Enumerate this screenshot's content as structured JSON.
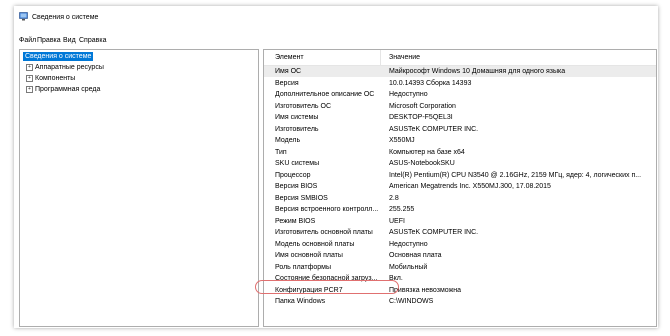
{
  "window": {
    "title": "Сведения о системе"
  },
  "menu": [
    "Файл",
    "Правка",
    "Вид",
    "Справка"
  ],
  "tree": [
    {
      "label": "Сведения о системе",
      "selected": true
    },
    {
      "label": "Аппаратные ресурсы"
    },
    {
      "label": "Компоненты"
    },
    {
      "label": "Программная среда"
    }
  ],
  "table": {
    "headers": [
      "Элемент",
      "Значение"
    ],
    "rows": [
      [
        "Имя ОС",
        "Майкрософт Windows 10 Домашняя для одного языка"
      ],
      [
        "Версия",
        "10.0.14393 Сборка 14393"
      ],
      [
        "Дополнительное описание ОС",
        "Недоступно"
      ],
      [
        "Изготовитель ОС",
        "Microsoft Corporation"
      ],
      [
        "Имя системы",
        "DESKTOP-F5QEL3I"
      ],
      [
        "Изготовитель",
        "ASUSTeK COMPUTER INC."
      ],
      [
        "Модель",
        "X550MJ"
      ],
      [
        "Тип",
        "Компьютер на базе x64"
      ],
      [
        "SKU системы",
        "ASUS-NotebookSKU"
      ],
      [
        "Процессор",
        "Intel(R) Pentium(R) CPU  N3540 @ 2.16GHz, 2159 МГц, ядер: 4, логических п..."
      ],
      [
        "Версия BIOS",
        "American Megatrends Inc. X550MJ.300, 17.08.2015"
      ],
      [
        "Версия SMBIOS",
        "2.8"
      ],
      [
        "Версия встроенного контролл...",
        "255.255"
      ],
      [
        "Режим BIOS",
        "UEFI"
      ],
      [
        "Изготовитель основной платы",
        "ASUSTeK COMPUTER INC."
      ],
      [
        "Модель основной платы",
        "Недоступно"
      ],
      [
        "Имя основной платы",
        "Основная плата"
      ],
      [
        "Роль платформы",
        "Мобильный"
      ],
      [
        "Состояние безопасной загруз...",
        "Вкл."
      ],
      [
        "Конфигурация PCR7",
        "Привязка невозможна"
      ],
      [
        "Папка Windows",
        "C:\\WINDOWS"
      ]
    ]
  }
}
